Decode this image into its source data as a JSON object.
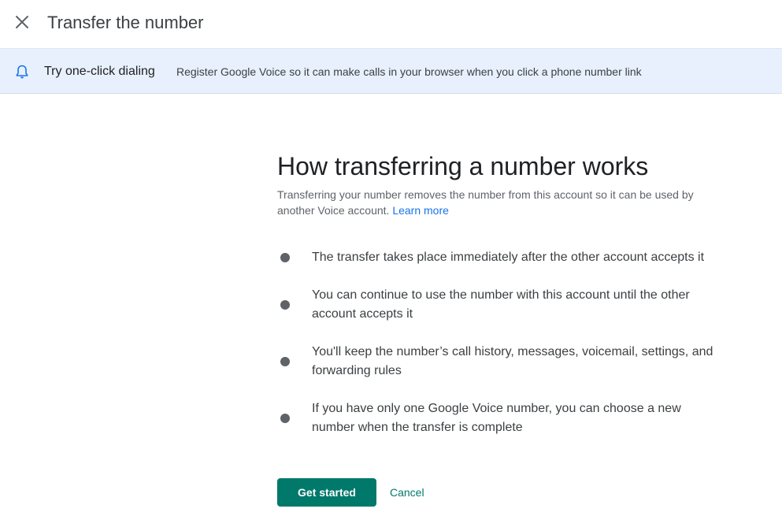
{
  "header": {
    "title": "Transfer the number",
    "close_icon": "close-icon"
  },
  "banner": {
    "icon": "bell-icon",
    "title": "Try one-click dialing",
    "text": "Register Google Voice so it can make calls in your browser when you click a phone number link",
    "background": "#e8f0fe"
  },
  "main": {
    "heading": "How transferring a number works",
    "intro": "Transferring your number removes the number from this account so it can be used by another Voice account.",
    "learn_more": "Learn more",
    "items": [
      "The transfer takes place immediately after the other account accepts it",
      "You can continue to use the number with this account until the other account accepts it",
      "You'll keep the number’s call history, messages, voicemail, settings, and forwarding rules",
      "If you have only one Google Voice number, you can choose a new number when the transfer is complete"
    ]
  },
  "actions": {
    "get_started": "Get started",
    "cancel": "Cancel",
    "accent": "#00796b"
  }
}
